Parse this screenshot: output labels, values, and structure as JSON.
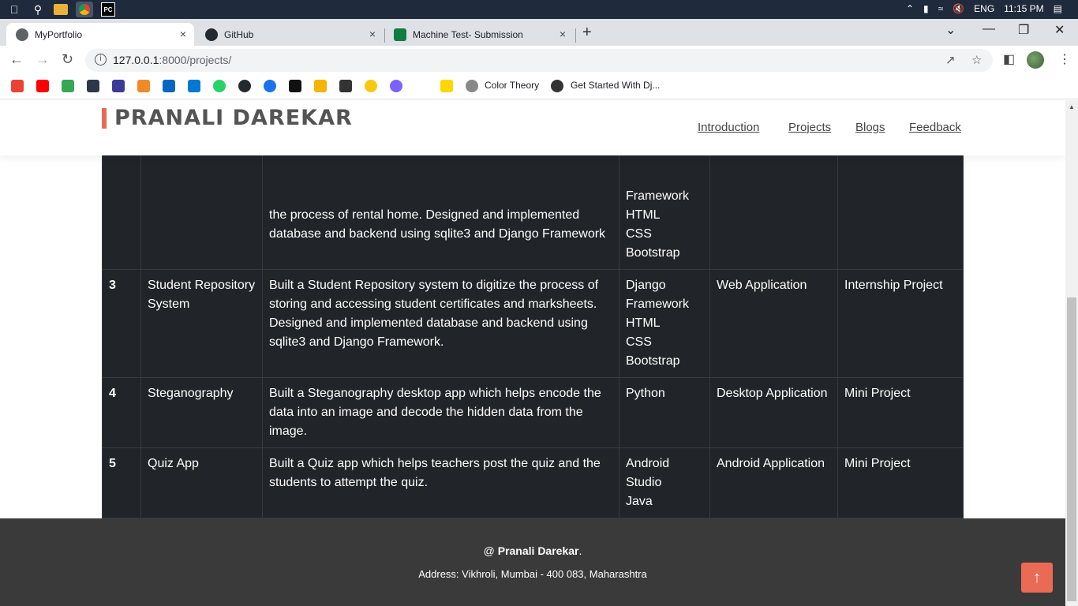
{
  "os": {
    "lang": "ENG",
    "time": "11:15 PM"
  },
  "tabs": [
    {
      "title": "MyPortfolio",
      "close": "×"
    },
    {
      "title": "GitHub",
      "close": "×"
    },
    {
      "title": "Machine Test- Submission",
      "close": "×"
    }
  ],
  "address": {
    "host": "127.0.0.1",
    "path": ":8000/projects/"
  },
  "bookmarks": [
    {
      "label": "Color Theory"
    },
    {
      "label": "Get Started With Dj..."
    }
  ],
  "site": {
    "name": "PRANALI DAREKAR",
    "nav": [
      "Introduction",
      "Projects",
      "Blogs",
      "Feedback"
    ]
  },
  "projects": [
    {
      "num": "",
      "name": "",
      "desc_lines": [
        "the process of rental home. Designed and implemented",
        "database and backend using sqlite3 and Django Framework"
      ],
      "tech": [
        "Framework",
        "HTML",
        "CSS",
        "Bootstrap"
      ],
      "type": "",
      "category": ""
    },
    {
      "num": "3",
      "name": "Student Repository System",
      "desc": "Built a Student Repository system to digitize the process of storing and accessing student certificates and marksheets. Designed and implemented database and backend using sqlite3 and Django Framework.",
      "tech": [
        "Django",
        "Framework",
        "HTML",
        "CSS",
        "Bootstrap"
      ],
      "type": "Web Application",
      "category": "Internship Project"
    },
    {
      "num": "4",
      "name": "Steganography",
      "desc": "Built a Steganography desktop app which helps encode the data into an image and decode the hidden data from the image.",
      "tech": [
        "Python"
      ],
      "type": "Desktop Application",
      "category": "Mini Project"
    },
    {
      "num": "5",
      "name": "Quiz App",
      "desc": "Built a Quiz app which helps teachers post the quiz and the students to attempt the quiz.",
      "tech": [
        "Android",
        "Studio",
        "Java"
      ],
      "type": "Android Application",
      "category": "Mini Project"
    }
  ],
  "footer": {
    "prefix": "@ ",
    "name": "Pranali Darekar",
    "suffix": ".",
    "address": "Address: Vikhroli, Mumbai - 400 083, Maharashtra"
  },
  "colors": {
    "accent": "#e96b56",
    "table_bg": "#212529",
    "footer_bg": "#3a3a3a"
  }
}
